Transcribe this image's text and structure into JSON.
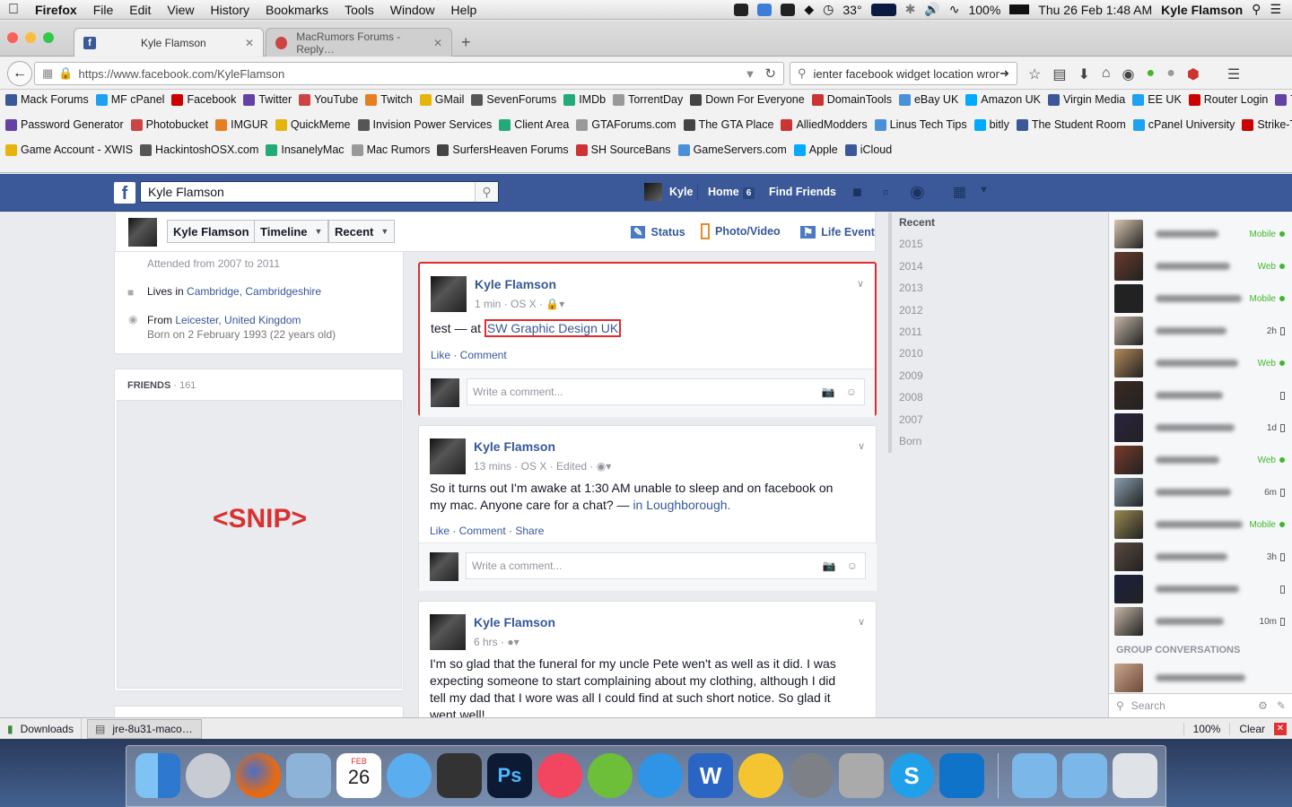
{
  "menubar": {
    "app": "Firefox",
    "items": [
      "File",
      "Edit",
      "View",
      "History",
      "Bookmarks",
      "Tools",
      "Window",
      "Help"
    ],
    "temp": "33°",
    "battery": "100%",
    "clock": "Thu 26 Feb  1:48 AM",
    "user": "Kyle Flamson"
  },
  "tabs": [
    {
      "label": "Kyle Flamson"
    },
    {
      "label": "MacRumors Forums - Reply…"
    }
  ],
  "nav": {
    "url": "https://www.facebook.com/KyleFlamson",
    "search": "ienter facebook widget location wrong"
  },
  "bookmarks": {
    "row1": [
      "Mack Forums",
      "MF cPanel",
      "Facebook",
      "Twitter",
      "YouTube",
      "Twitch",
      "GMail",
      "SevenForums",
      "IMDb",
      "TorrentDay",
      "Down For Everyone",
      "DomainTools",
      "eBay UK",
      "Amazon UK",
      "Virgin Media",
      "EE UK",
      "Router Login",
      "TinyPic"
    ],
    "row2": [
      "Password Generator",
      "Photobucket",
      "IMGUR",
      "QuickMeme",
      "Invision Power Services",
      "Client Area",
      "GTAForums.com",
      "The GTA Place",
      "AlliedModders",
      "Linus Tech Tips",
      "bitly",
      "The Student Room",
      "cPanel University",
      "Strike-Team XWIS"
    ],
    "row3": [
      "Game Account - XWIS",
      "HackintoshOSX.com",
      "InsanelyMac",
      "Mac Rumors",
      "SurfersHeaven Forums",
      "SH SourceBans",
      "GameServers.com",
      "Apple",
      "iCloud"
    ]
  },
  "fb": {
    "search_value": "Kyle Flamson",
    "nav": {
      "profile": "Kyle",
      "home": "Home",
      "home_count": "6",
      "find_friends": "Find Friends"
    },
    "subnav": {
      "name": "Kyle Flamson",
      "timeline": "Timeline",
      "recent": "Recent",
      "status": "Status",
      "photo": "Photo/Video",
      "life": "Life Event"
    },
    "about": {
      "attended": "Attended from 2007 to 2011",
      "lives_prefix": "Lives in ",
      "lives_city": "Cambridge, Cambridgeshire",
      "from_prefix": "From ",
      "from_city": "Leicester, United Kingdom",
      "born": "Born on 2 February 1993 (22 years old)"
    },
    "friends": {
      "label": "FRIENDS",
      "count": "· 161",
      "snip": "<SNIP>"
    },
    "posts": [
      {
        "name": "Kyle Flamson",
        "meta": "1 min · OS X ·",
        "text_prefix": "test — at ",
        "place": "SW Graphic Design UK",
        "actions": "Like · Comment",
        "comment_placeholder": "Write a comment..."
      },
      {
        "name": "Kyle Flamson",
        "meta": "13 mins · OS X · Edited ·",
        "text": "So it turns out I'm awake at 1:30 AM unable to sleep and on facebook on my mac. Anyone care for a chat? — ",
        "place": "in Loughborough.",
        "actions": "Like · Comment · Share",
        "comment_placeholder": "Write a comment..."
      },
      {
        "name": "Kyle Flamson",
        "meta": "6 hrs ·",
        "text": "I'm so glad that the funeral for my uncle Pete wen't as well as it did. I was expecting someone to start complaining about my clothing, although I did tell my dad that I wore was all I could find at such short notice. So glad it went well!"
      }
    ],
    "years": [
      "Recent",
      "2015",
      "2014",
      "2013",
      "2012",
      "2011",
      "2010",
      "2009",
      "2008",
      "2007",
      "Born"
    ],
    "chat": {
      "statuses": [
        "Mobile",
        "Web",
        "Mobile",
        "2h",
        "Web",
        "",
        "1d",
        "Web",
        "6m",
        "Mobile",
        "3h",
        "",
        "10m"
      ],
      "group_label": "GROUP CONVERSATIONS",
      "search_placeholder": "Search"
    }
  },
  "downloads": {
    "label": "Downloads",
    "file": "jre-8u31-maco…",
    "zoom": "100%",
    "clear": "Clear"
  },
  "dock": {
    "date_month": "FEB",
    "date_day": "26"
  }
}
